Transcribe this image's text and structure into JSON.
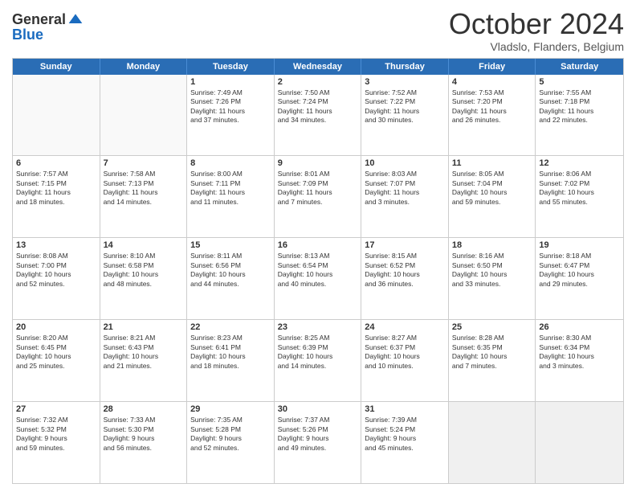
{
  "header": {
    "logo_general": "General",
    "logo_blue": "Blue",
    "month_title": "October 2024",
    "location": "Vladslo, Flanders, Belgium"
  },
  "calendar": {
    "days_of_week": [
      "Sunday",
      "Monday",
      "Tuesday",
      "Wednesday",
      "Thursday",
      "Friday",
      "Saturday"
    ],
    "weeks": [
      [
        {
          "day": "",
          "content": "",
          "empty": true
        },
        {
          "day": "",
          "content": "",
          "empty": true
        },
        {
          "day": "1",
          "content": "Sunrise: 7:49 AM\nSunset: 7:26 PM\nDaylight: 11 hours\nand 37 minutes.",
          "empty": false
        },
        {
          "day": "2",
          "content": "Sunrise: 7:50 AM\nSunset: 7:24 PM\nDaylight: 11 hours\nand 34 minutes.",
          "empty": false
        },
        {
          "day": "3",
          "content": "Sunrise: 7:52 AM\nSunset: 7:22 PM\nDaylight: 11 hours\nand 30 minutes.",
          "empty": false
        },
        {
          "day": "4",
          "content": "Sunrise: 7:53 AM\nSunset: 7:20 PM\nDaylight: 11 hours\nand 26 minutes.",
          "empty": false
        },
        {
          "day": "5",
          "content": "Sunrise: 7:55 AM\nSunset: 7:18 PM\nDaylight: 11 hours\nand 22 minutes.",
          "empty": false
        }
      ],
      [
        {
          "day": "6",
          "content": "Sunrise: 7:57 AM\nSunset: 7:15 PM\nDaylight: 11 hours\nand 18 minutes.",
          "empty": false
        },
        {
          "day": "7",
          "content": "Sunrise: 7:58 AM\nSunset: 7:13 PM\nDaylight: 11 hours\nand 14 minutes.",
          "empty": false
        },
        {
          "day": "8",
          "content": "Sunrise: 8:00 AM\nSunset: 7:11 PM\nDaylight: 11 hours\nand 11 minutes.",
          "empty": false
        },
        {
          "day": "9",
          "content": "Sunrise: 8:01 AM\nSunset: 7:09 PM\nDaylight: 11 hours\nand 7 minutes.",
          "empty": false
        },
        {
          "day": "10",
          "content": "Sunrise: 8:03 AM\nSunset: 7:07 PM\nDaylight: 11 hours\nand 3 minutes.",
          "empty": false
        },
        {
          "day": "11",
          "content": "Sunrise: 8:05 AM\nSunset: 7:04 PM\nDaylight: 10 hours\nand 59 minutes.",
          "empty": false
        },
        {
          "day": "12",
          "content": "Sunrise: 8:06 AM\nSunset: 7:02 PM\nDaylight: 10 hours\nand 55 minutes.",
          "empty": false
        }
      ],
      [
        {
          "day": "13",
          "content": "Sunrise: 8:08 AM\nSunset: 7:00 PM\nDaylight: 10 hours\nand 52 minutes.",
          "empty": false
        },
        {
          "day": "14",
          "content": "Sunrise: 8:10 AM\nSunset: 6:58 PM\nDaylight: 10 hours\nand 48 minutes.",
          "empty": false
        },
        {
          "day": "15",
          "content": "Sunrise: 8:11 AM\nSunset: 6:56 PM\nDaylight: 10 hours\nand 44 minutes.",
          "empty": false
        },
        {
          "day": "16",
          "content": "Sunrise: 8:13 AM\nSunset: 6:54 PM\nDaylight: 10 hours\nand 40 minutes.",
          "empty": false
        },
        {
          "day": "17",
          "content": "Sunrise: 8:15 AM\nSunset: 6:52 PM\nDaylight: 10 hours\nand 36 minutes.",
          "empty": false
        },
        {
          "day": "18",
          "content": "Sunrise: 8:16 AM\nSunset: 6:50 PM\nDaylight: 10 hours\nand 33 minutes.",
          "empty": false
        },
        {
          "day": "19",
          "content": "Sunrise: 8:18 AM\nSunset: 6:47 PM\nDaylight: 10 hours\nand 29 minutes.",
          "empty": false
        }
      ],
      [
        {
          "day": "20",
          "content": "Sunrise: 8:20 AM\nSunset: 6:45 PM\nDaylight: 10 hours\nand 25 minutes.",
          "empty": false
        },
        {
          "day": "21",
          "content": "Sunrise: 8:21 AM\nSunset: 6:43 PM\nDaylight: 10 hours\nand 21 minutes.",
          "empty": false
        },
        {
          "day": "22",
          "content": "Sunrise: 8:23 AM\nSunset: 6:41 PM\nDaylight: 10 hours\nand 18 minutes.",
          "empty": false
        },
        {
          "day": "23",
          "content": "Sunrise: 8:25 AM\nSunset: 6:39 PM\nDaylight: 10 hours\nand 14 minutes.",
          "empty": false
        },
        {
          "day": "24",
          "content": "Sunrise: 8:27 AM\nSunset: 6:37 PM\nDaylight: 10 hours\nand 10 minutes.",
          "empty": false
        },
        {
          "day": "25",
          "content": "Sunrise: 8:28 AM\nSunset: 6:35 PM\nDaylight: 10 hours\nand 7 minutes.",
          "empty": false
        },
        {
          "day": "26",
          "content": "Sunrise: 8:30 AM\nSunset: 6:34 PM\nDaylight: 10 hours\nand 3 minutes.",
          "empty": false
        }
      ],
      [
        {
          "day": "27",
          "content": "Sunrise: 7:32 AM\nSunset: 5:32 PM\nDaylight: 9 hours\nand 59 minutes.",
          "empty": false
        },
        {
          "day": "28",
          "content": "Sunrise: 7:33 AM\nSunset: 5:30 PM\nDaylight: 9 hours\nand 56 minutes.",
          "empty": false
        },
        {
          "day": "29",
          "content": "Sunrise: 7:35 AM\nSunset: 5:28 PM\nDaylight: 9 hours\nand 52 minutes.",
          "empty": false
        },
        {
          "day": "30",
          "content": "Sunrise: 7:37 AM\nSunset: 5:26 PM\nDaylight: 9 hours\nand 49 minutes.",
          "empty": false
        },
        {
          "day": "31",
          "content": "Sunrise: 7:39 AM\nSunset: 5:24 PM\nDaylight: 9 hours\nand 45 minutes.",
          "empty": false
        },
        {
          "day": "",
          "content": "",
          "empty": true,
          "shaded": true
        },
        {
          "day": "",
          "content": "",
          "empty": true,
          "shaded": true
        }
      ]
    ]
  }
}
